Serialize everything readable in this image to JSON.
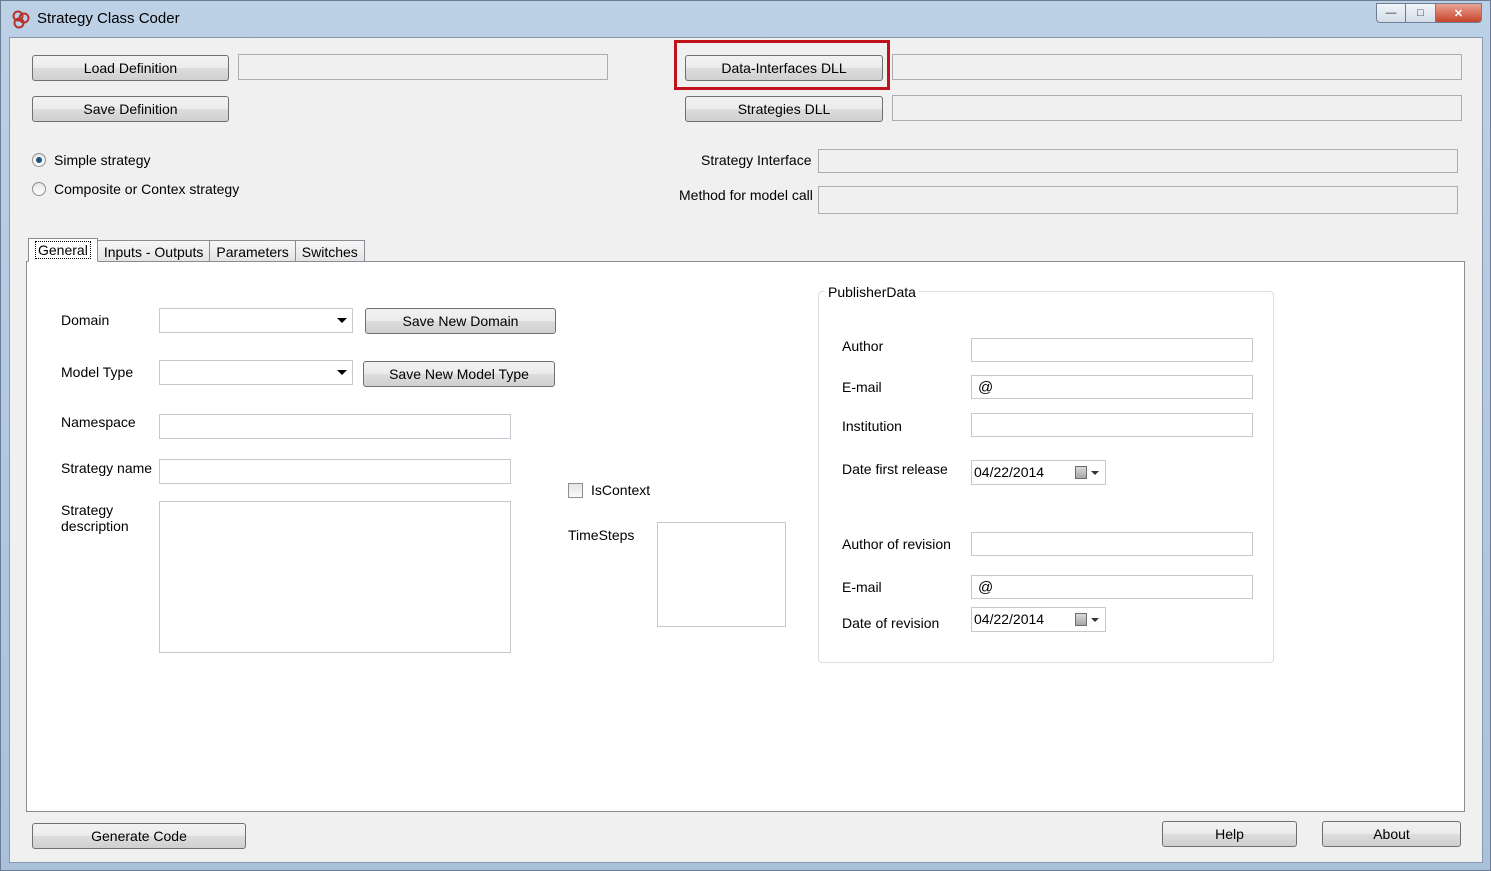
{
  "window": {
    "title": "Strategy Class Coder",
    "minimize_glyph": "—",
    "maximize_glyph": "□",
    "close_glyph": "✕"
  },
  "top": {
    "load_definition": "Load Definition",
    "save_definition": "Save Definition",
    "data_interfaces_dll": "Data-Interfaces DLL",
    "strategies_dll": "Strategies DLL",
    "strategy_interface_label": "Strategy Interface",
    "method_label": "Method for model call"
  },
  "strategy_kind": {
    "simple": "Simple strategy",
    "composite": "Composite or Contex strategy",
    "selected": "simple"
  },
  "tabs": [
    {
      "label": "General",
      "active": true
    },
    {
      "label": "Inputs - Outputs",
      "active": false
    },
    {
      "label": "Parameters",
      "active": false
    },
    {
      "label": "Switches",
      "active": false
    }
  ],
  "general": {
    "domain_label": "Domain",
    "save_new_domain": "Save New Domain",
    "model_type_label": "Model Type",
    "save_new_model_type": "Save New Model Type",
    "namespace_label": "Namespace",
    "strategy_name_label": "Strategy name",
    "strategy_description_label_1": "Strategy",
    "strategy_description_label_2": "description",
    "is_context_label": "IsContext",
    "timesteps_label": "TimeSteps"
  },
  "publisher": {
    "title": "PublisherData",
    "author_label": "Author",
    "email_label": "E-mail",
    "email_value": "@",
    "institution_label": "Institution",
    "date_first_release_label": "Date first release",
    "date_first_release_value": "04/22/2014",
    "author_revision_label": "Author of revision",
    "email2_label": "E-mail",
    "email2_value": "@",
    "date_revision_label": "Date of revision",
    "date_revision_value": "04/22/2014"
  },
  "bottom": {
    "generate_code": "Generate Code",
    "help": "Help",
    "about": "About"
  },
  "colors": {
    "highlight": "#c0121c",
    "radio_dot": "#1c5180"
  }
}
